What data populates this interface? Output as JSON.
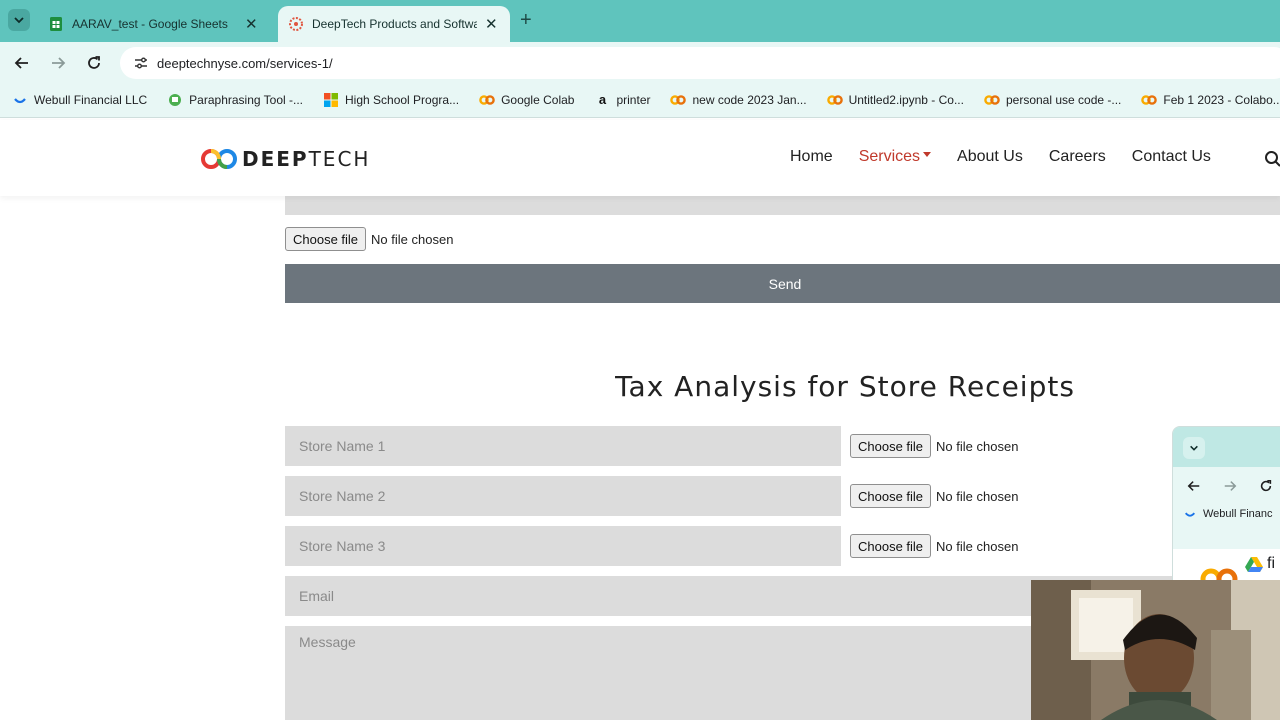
{
  "browser": {
    "tabs": [
      {
        "title": "AARAV_test - Google Sheets",
        "icon": "sheets-icon",
        "active": false
      },
      {
        "title": "DeepTech Products and Softwa",
        "icon": "deeptech-favicon-icon",
        "active": true
      }
    ],
    "url": "deeptechnyse.com/services-1/",
    "bookmarks": [
      {
        "label": "Webull Financial LLC",
        "icon": "webull-icon"
      },
      {
        "label": "Paraphrasing Tool -...",
        "icon": "quillbot-icon"
      },
      {
        "label": "High School Progra...",
        "icon": "microsoft-icon"
      },
      {
        "label": "Google Colab",
        "icon": "colab-icon"
      },
      {
        "label": "printer",
        "icon": "amazon-icon"
      },
      {
        "label": "new code 2023 Jan...",
        "icon": "colab-icon"
      },
      {
        "label": "Untitled2.ipynb - Co...",
        "icon": "colab-icon"
      },
      {
        "label": "personal use code -...",
        "icon": "colab-icon"
      },
      {
        "label": "Feb 1 2023 - Colabo...",
        "icon": "colab-icon"
      }
    ]
  },
  "site": {
    "logo_text_bold": "DEEP",
    "logo_text_light": "TECH",
    "nav": [
      "Home",
      "Services",
      "About Us",
      "Careers",
      "Contact Us"
    ],
    "active_nav": "Services"
  },
  "content": {
    "upper_form": {
      "file_button": "Choose file",
      "file_status": "No file chosen",
      "send_label": "Send"
    },
    "tax_section": {
      "title": "Tax Analysis for Store Receipts",
      "stores": [
        {
          "placeholder": "Store Name 1",
          "file_button": "Choose file",
          "file_status": "No file chosen"
        },
        {
          "placeholder": "Store Name 2",
          "file_button": "Choose file",
          "file_status": "No file chosen"
        },
        {
          "placeholder": "Store Name 3",
          "file_button": "Choose file",
          "file_status": "No file chosen"
        }
      ],
      "email_placeholder": "Email",
      "message_placeholder": "Message"
    }
  },
  "overlay_window": {
    "bookmark": "Webull Financ",
    "partial_text": "fi"
  },
  "colors": {
    "chrome_tabbar": "#5fc4bd",
    "chrome_toolbar": "#e8f7f5",
    "active_nav": "#c0392b",
    "send_button": "#6c757d",
    "field_bg": "#dcdcdc"
  }
}
